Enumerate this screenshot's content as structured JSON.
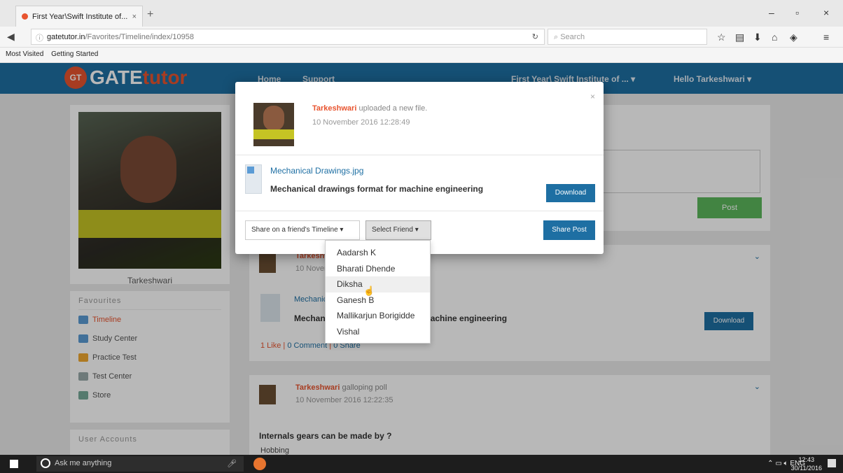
{
  "browser": {
    "tab_title": "First Year\\Swift Institute of...",
    "tab_close": "×",
    "new_tab": "+",
    "url_domain": "gatetutor.in",
    "url_path": "/Favorites/Timeline/index/10958",
    "search_placeholder": "Search",
    "bookmarks": [
      "Most Visited",
      "Getting Started"
    ],
    "minimize": "–",
    "maximize": "▫",
    "close": "×"
  },
  "site": {
    "logo_gt": "GT",
    "logo_gate": "GATE",
    "logo_tutor": "tutor",
    "nav": [
      "Home",
      "Support"
    ],
    "institute_menu": "First Year\\ Swift Institute of ... ▾",
    "user_menu": "Hello Tarkeshwari ▾"
  },
  "sidebar": {
    "profile_name": "Tarkeshwari",
    "favourites_heading": "Favourites",
    "favourites": [
      "Timeline",
      "Study Center",
      "Practice Test",
      "Test Center",
      "Store"
    ],
    "user_accounts_heading": "User Accounts"
  },
  "main": {
    "post_button": "Post",
    "feed_post": {
      "author": "Tarkeshwari",
      "date": "10 November 2016 12:28:49",
      "file_name": "Mechanical Drawings.jpg",
      "description": "Mechanical drawings format for machine engineering",
      "download": "Download",
      "likes": "1 Like",
      "comments": "0 Comment",
      "shares": "0 Share"
    },
    "poll_post": {
      "author": "Tarkeshwari",
      "action": "galloping poll",
      "date": "10 November 2016 12:22:35",
      "question": "Internals gears can be made by ?",
      "first_option": "Hobbing"
    }
  },
  "modal": {
    "close": "×",
    "author": "Tarkeshwari",
    "action": "uploaded a new file.",
    "date": "10 November 2016 12:28:49",
    "file_name": "Mechanical Drawings.jpg",
    "description": "Mechanical drawings format for machine engineering",
    "download": "Download",
    "share_target": "Share on a friend's Timeline ▾",
    "select_friend": "Select Friend ▾",
    "share_post": "Share Post",
    "friends": [
      "Aadarsh K",
      "Bharati Dhende",
      "Diksha",
      "Ganesh B",
      "Mallikarjun Borigidde",
      "Vishal"
    ],
    "hovered_friend": "Diksha"
  },
  "taskbar": {
    "search_placeholder": "Ask me anything",
    "language": "ENG",
    "time": "12:43",
    "date": "30/11/2016"
  },
  "colors": {
    "header_blue": "#1e6fa3",
    "accent_orange": "#e8542f",
    "post_green": "#5cb85c"
  }
}
